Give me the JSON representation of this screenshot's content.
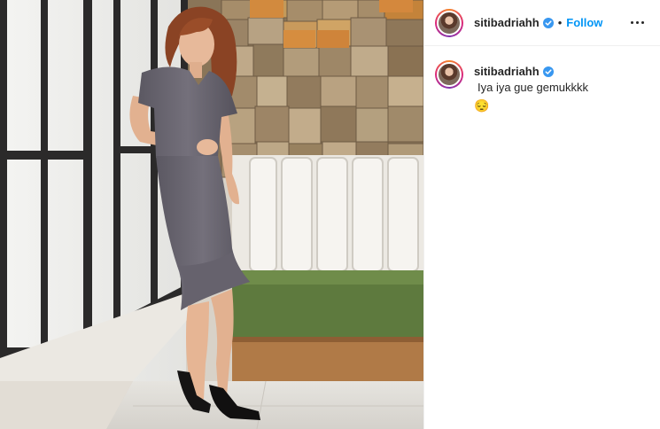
{
  "post": {
    "username": "siti​badriahh",
    "verified": true,
    "separator": "•",
    "follow_label": "Follow",
    "more_icon": "more-horizontal-icon"
  },
  "caption": {
    "username": "siti​badriahh",
    "text": "Iya iya gue gemukkkk",
    "emoji": "😔"
  },
  "colors": {
    "accent": "#0095f6",
    "verified": "#3897f0",
    "text": "#262626"
  }
}
